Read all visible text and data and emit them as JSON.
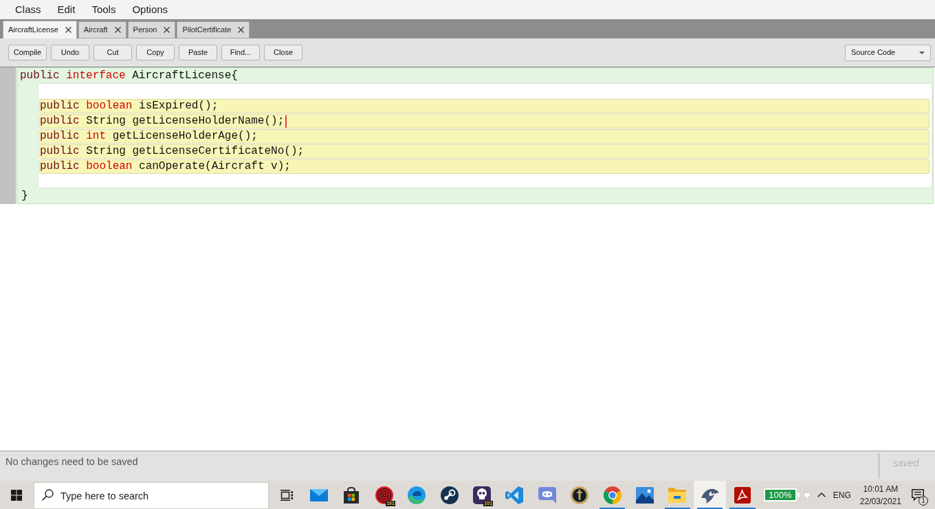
{
  "menu": [
    "Class",
    "Edit",
    "Tools",
    "Options"
  ],
  "tabs": [
    {
      "label": "AircraftLicense",
      "selected": true
    },
    {
      "label": "Aircraft",
      "selected": false
    },
    {
      "label": "Person",
      "selected": false
    },
    {
      "label": "PilotCertificate",
      "selected": false
    }
  ],
  "toolbar": {
    "buttons": [
      "Compile",
      "Undo",
      "Cut",
      "Copy",
      "Paste",
      "Find...",
      "Close"
    ],
    "view_select": {
      "value": "Source Code"
    }
  },
  "editor": {
    "header": [
      {
        "text": "public",
        "kind": "modifier"
      },
      {
        "text": "interface",
        "kind": "keyword"
      },
      {
        "text": "AircraftLicense{",
        "kind": "name"
      }
    ],
    "methods": [
      {
        "tokens": [
          {
            "text": "public",
            "kind": "modifier"
          },
          {
            "text": "boolean",
            "kind": "keyword"
          },
          {
            "text": "isExpired();",
            "kind": "name"
          }
        ],
        "cursor": false
      },
      {
        "tokens": [
          {
            "text": "public",
            "kind": "modifier"
          },
          {
            "text": "String",
            "kind": "name"
          },
          {
            "text": "getLicenseHolderName();",
            "kind": "name"
          }
        ],
        "cursor": true
      },
      {
        "tokens": [
          {
            "text": "public",
            "kind": "modifier"
          },
          {
            "text": "int",
            "kind": "keyword"
          },
          {
            "text": "getLicenseHolderAge();",
            "kind": "name"
          }
        ],
        "cursor": false
      },
      {
        "tokens": [
          {
            "text": "public",
            "kind": "modifier"
          },
          {
            "text": "String",
            "kind": "name"
          },
          {
            "text": "getLicenseCertificateNo();",
            "kind": "name"
          }
        ],
        "cursor": false
      },
      {
        "tokens": [
          {
            "text": "public",
            "kind": "modifier"
          },
          {
            "text": "boolean",
            "kind": "keyword"
          },
          {
            "text": "canOperate(Aircraft v);",
            "kind": "name"
          }
        ],
        "cursor": false
      }
    ],
    "footer": [
      {
        "text": "}",
        "kind": "name"
      }
    ]
  },
  "status_bar": {
    "message": "No changes need to be saved",
    "save_state": "saved"
  },
  "taskbar": {
    "search": {
      "placeholder": "Type here to search"
    },
    "apps": [
      {
        "kind": "task-view",
        "running": false,
        "selected": false
      },
      {
        "kind": "mail",
        "running": false,
        "selected": false
      },
      {
        "kind": "store",
        "running": false,
        "selected": false
      },
      {
        "kind": "spiral",
        "running": false,
        "selected": false,
        "badge": "101"
      },
      {
        "kind": "swirl",
        "running": false,
        "selected": false
      },
      {
        "kind": "piston",
        "running": false,
        "selected": false
      },
      {
        "kind": "skull",
        "running": false,
        "selected": false,
        "badge": "101"
      },
      {
        "kind": "ribbon",
        "running": false,
        "selected": false
      },
      {
        "kind": "chat-face",
        "running": false,
        "selected": false
      },
      {
        "kind": "ring",
        "running": false,
        "selected": false
      },
      {
        "kind": "tricolor",
        "running": true,
        "selected": false
      },
      {
        "kind": "photos",
        "running": false,
        "selected": false
      },
      {
        "kind": "folder",
        "running": true,
        "selected": false
      },
      {
        "kind": "bird",
        "running": true,
        "selected": true
      },
      {
        "kind": "pdf",
        "running": true,
        "selected": false
      }
    ],
    "tray": {
      "battery": "100%",
      "language": "ENG",
      "time": "10:01 AM",
      "date": "22/03/2021",
      "notifications": "1"
    }
  }
}
